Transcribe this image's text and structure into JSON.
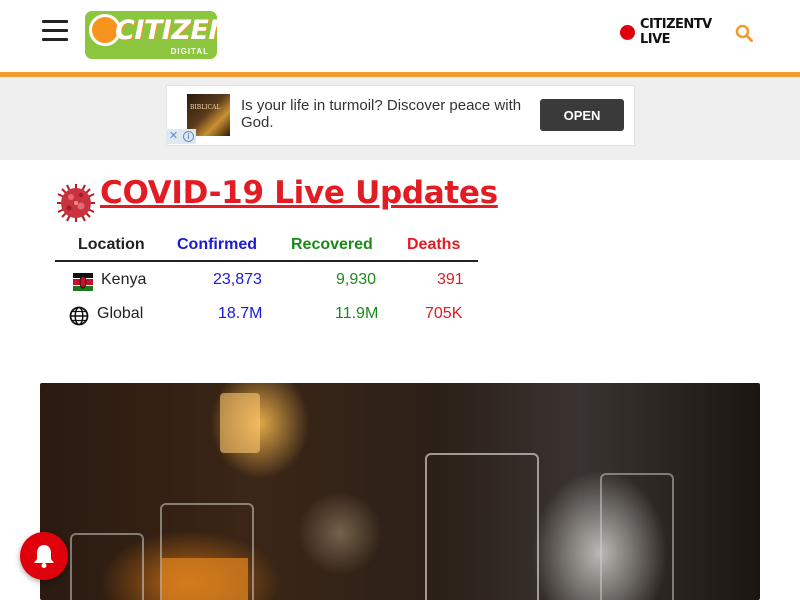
{
  "header": {
    "logo_text": "CITIZEN",
    "logo_sub": "DIGITAL",
    "live_label": "CITIZENTV\nLIVE",
    "icons": {
      "menu": "hamburger-menu-icon",
      "search": "search-icon",
      "live": "live-dot-icon"
    },
    "colors": {
      "accent": "#f39c2d",
      "logo_bg": "#8cc63f",
      "live": "#e0000b"
    }
  },
  "ad": {
    "text": "Is your life in turmoil? Discover peace with God.",
    "thumb_text": "BIBLICAL",
    "button_label": "OPEN",
    "close_glyph": "✕",
    "info_glyph": "i"
  },
  "covid": {
    "title": "COVID-19 Live Updates",
    "columns": [
      "Location",
      "Confirmed",
      "Recovered",
      "Deaths"
    ],
    "rows": [
      {
        "location": "Kenya",
        "confirmed": "23,873",
        "recovered": "9,930",
        "deaths": "391"
      },
      {
        "location": "Global",
        "confirmed": "18.7M",
        "recovered": "11.9M",
        "deaths": "705K"
      }
    ],
    "colors": {
      "title": "#e31b23",
      "confirmed": "#1a1ad8",
      "recovered": "#1a8a1a",
      "deaths": "#e31b23"
    }
  },
  "hero": {
    "image": "whiskey-glasses-photo"
  },
  "notification": {
    "icon": "bell-icon"
  }
}
